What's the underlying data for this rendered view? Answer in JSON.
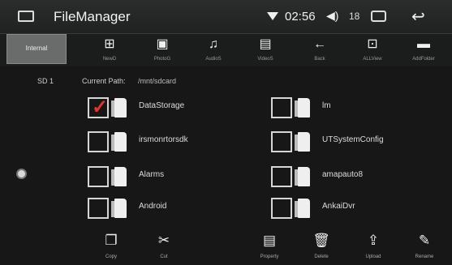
{
  "status_bar": {
    "app_title": "FileManager",
    "time": "02:56",
    "volume_level": "18",
    "icons": {
      "app": "window-icon",
      "wifi": "wifi-icon",
      "volume": "speaker-icon",
      "window": "window-icon",
      "back": "back-arrow-icon"
    }
  },
  "toolbar": {
    "selected_tab": "Internal",
    "items": [
      {
        "label": "NewD",
        "icon": "grid-icon",
        "glyph": "⊞"
      },
      {
        "label": "PhotoG",
        "icon": "photo-icon",
        "glyph": "▣"
      },
      {
        "label": "AudioS",
        "icon": "music-icon",
        "glyph": "♫"
      },
      {
        "label": "VideoS",
        "icon": "video-icon",
        "glyph": "▤"
      },
      {
        "label": "Back",
        "icon": "left-arrow-icon",
        "glyph": "←"
      },
      {
        "label": "ALLView",
        "icon": "grid-outline-icon",
        "glyph": "⊡"
      },
      {
        "label": "AddFolder",
        "icon": "new-folder-icon",
        "glyph": "▬"
      }
    ]
  },
  "browser": {
    "storage": "SD 1",
    "path_label": "Current Path:",
    "path_value": "/mnt/sdcard",
    "files": [
      {
        "name": "DataStorage",
        "sub": "",
        "checked": true
      },
      {
        "name": "lm",
        "sub": "",
        "checked": false
      },
      {
        "name": "irsmonrtorsdk",
        "sub": "",
        "checked": false
      },
      {
        "name": "UTSystemConfig",
        "sub": "",
        "checked": false
      },
      {
        "name": "Alarms",
        "sub": "",
        "checked": false
      },
      {
        "name": "amapauto8",
        "sub": "",
        "checked": false
      },
      {
        "name": "Android",
        "sub": "",
        "checked": false
      },
      {
        "name": "AnkaiDvr",
        "sub": "",
        "checked": false
      }
    ]
  },
  "actions": [
    {
      "label": "Copy",
      "icon": "copy-icon",
      "glyph": "❐"
    },
    {
      "label": "Cut",
      "icon": "scissors-icon",
      "glyph": "✂"
    },
    {
      "label": "Property",
      "icon": "property-icon",
      "glyph": "▤"
    },
    {
      "label": "Delete",
      "icon": "trash-icon",
      "glyph": "🗑"
    },
    {
      "label": "Upload",
      "icon": "upload-icon",
      "glyph": "⇪"
    },
    {
      "label": "Rename",
      "icon": "pencil-icon",
      "glyph": "✎"
    }
  ]
}
